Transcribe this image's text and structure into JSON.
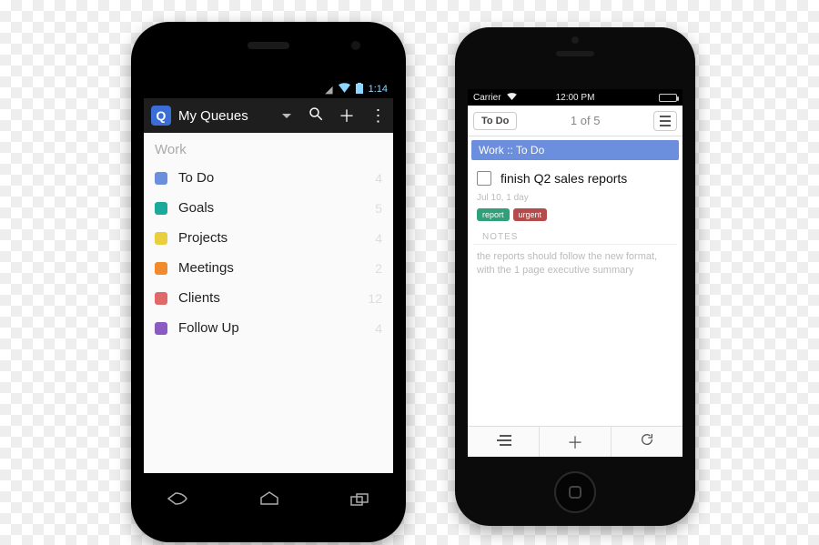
{
  "android": {
    "status": {
      "time": "1:14"
    },
    "actionbar": {
      "app_glyph": "Q",
      "title": "My Queues"
    },
    "section": "Work",
    "queues": [
      {
        "label": "To Do",
        "count": "4",
        "color": "#6b8fdc"
      },
      {
        "label": "Goals",
        "count": "5",
        "color": "#1aa99a"
      },
      {
        "label": "Projects",
        "count": "4",
        "color": "#e9cf3e"
      },
      {
        "label": "Meetings",
        "count": "2",
        "color": "#f08a2d"
      },
      {
        "label": "Clients",
        "count": "12",
        "color": "#e06a6a"
      },
      {
        "label": "Follow Up",
        "count": "4",
        "color": "#8b5bc2"
      }
    ]
  },
  "iphone": {
    "status": {
      "carrier": "Carrier",
      "time": "12:00 PM"
    },
    "nav": {
      "back_label": "To Do",
      "pager": "1 of 5"
    },
    "crumb": "Work :: To Do",
    "task": {
      "title": "finish Q2 sales reports",
      "meta": "Jul 10, 1 day",
      "tags": [
        {
          "text": "report",
          "color": "#2fa07a"
        },
        {
          "text": "urgent",
          "color": "#b64b4b"
        }
      ],
      "notes_label": "NOTES",
      "notes": "the reports should follow the new format, with the 1 page executive summary"
    }
  }
}
